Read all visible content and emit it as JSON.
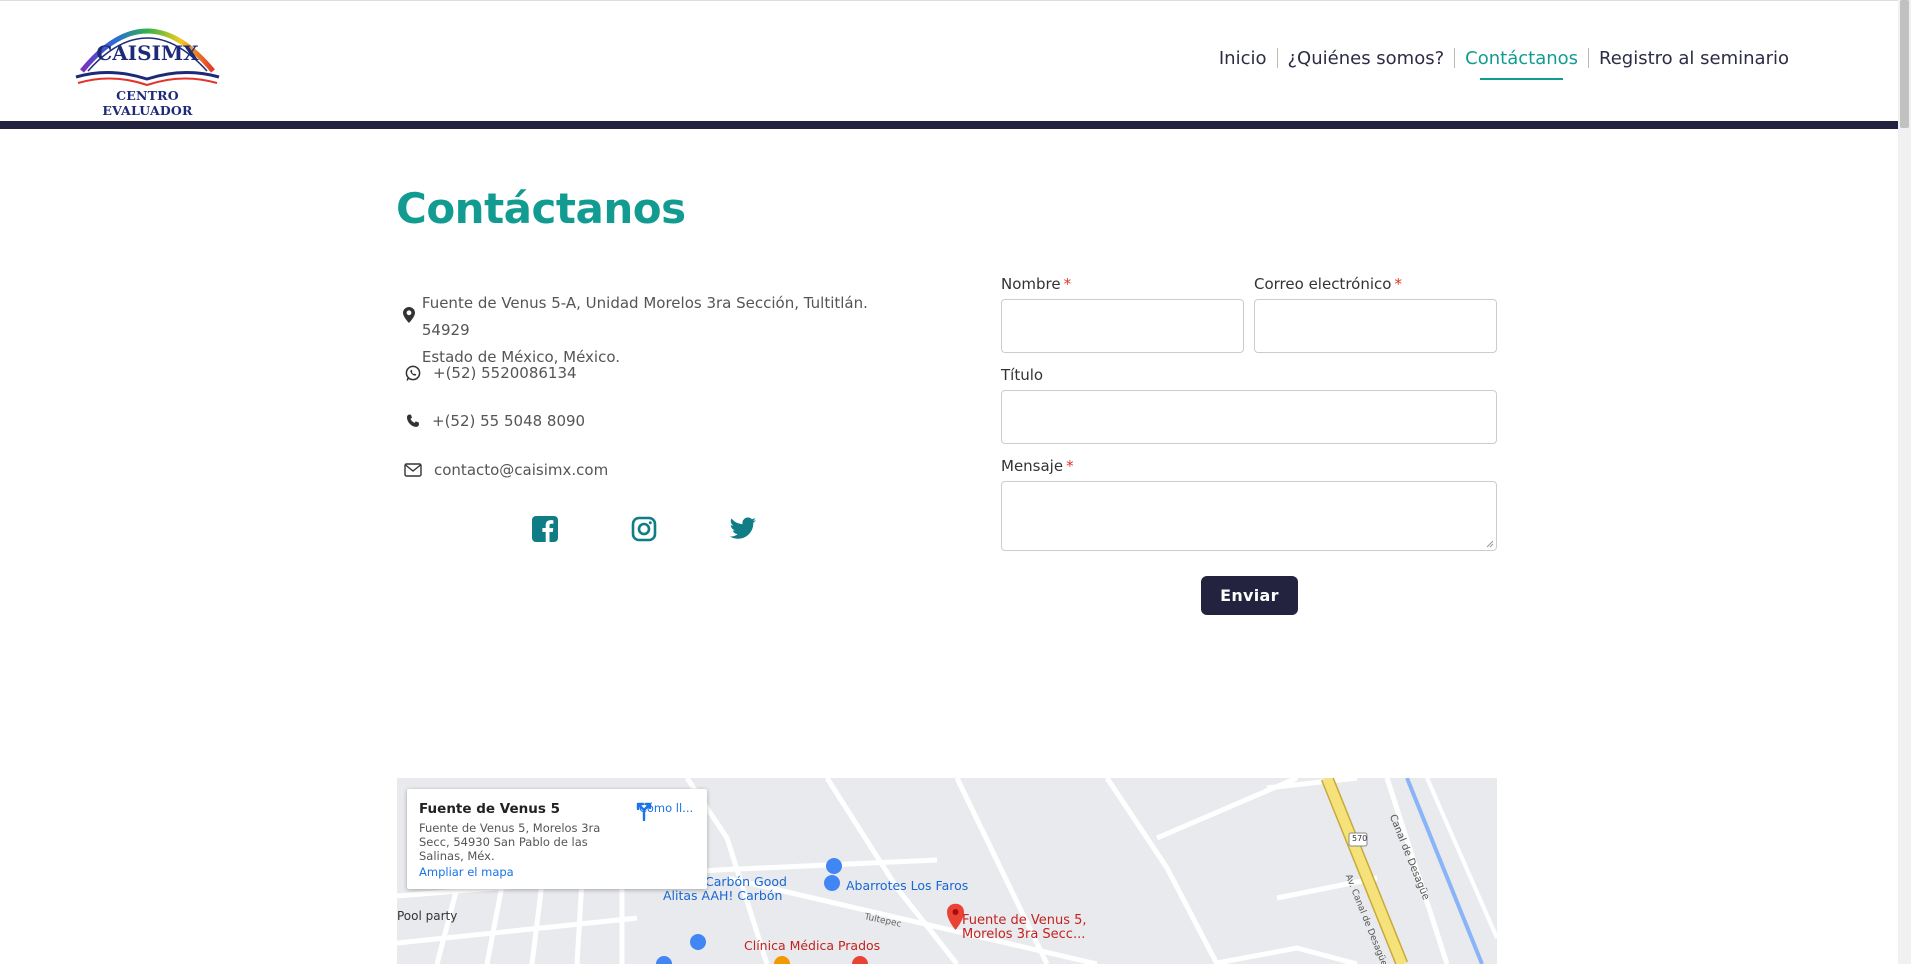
{
  "header": {
    "logo": {
      "main": "CAISIMX",
      "sub": "CENTRO EVALUADOR"
    },
    "nav": [
      {
        "label": "Inicio",
        "active": false
      },
      {
        "label": "¿Quiénes somos?",
        "active": false
      },
      {
        "label": "Contáctanos",
        "active": true
      },
      {
        "label": "Registro al seminario",
        "active": false
      }
    ]
  },
  "page": {
    "title": "Contáctanos"
  },
  "contact": {
    "address_line1": "Fuente de Venus 5-A, Unidad Morelos 3ra Sección, Tultitlán. 54929",
    "address_line2": "Estado de México, México.",
    "whatsapp": "+(52) 5520086134",
    "phone": "+(52) 55 5048 8090",
    "email": "contacto@caisimx.com",
    "social": [
      "facebook-icon",
      "instagram-icon",
      "twitter-icon"
    ]
  },
  "form": {
    "name_label": "Nombre",
    "email_label": "Correo electrónico",
    "title_label": "Título",
    "message_label": "Mensaje",
    "required_mark": "*",
    "submit_label": "Enviar"
  },
  "map": {
    "card_title": "Fuente de Venus 5",
    "card_address": "Fuente de Venus 5, Morelos 3ra Secc, 54930 San Pablo de las Salinas, Méx.",
    "directions_label": "Cómo ll...",
    "enlarge_label": "Ampliar el mapa",
    "pin_label_line1": "Fuente de Venus 5,",
    "pin_label_line2": "Morelos 3ra Secc...",
    "places": {
      "carbon_1": "Carbón Good",
      "carbon_2": "Alitas AAH! Carbón",
      "abarrotes": "Abarrotes Los Faros",
      "clinica": "Clínica Médica Prados",
      "pool": "Pool party",
      "tultepec": "Tultepec",
      "canal": "Canal de Desagüe",
      "av_canal": "Av. Canal de Desagüe",
      "route": "570"
    },
    "colors": {
      "water": "#8ab4f8",
      "highway": "#f6e27a",
      "pin": "#ea4335"
    }
  }
}
